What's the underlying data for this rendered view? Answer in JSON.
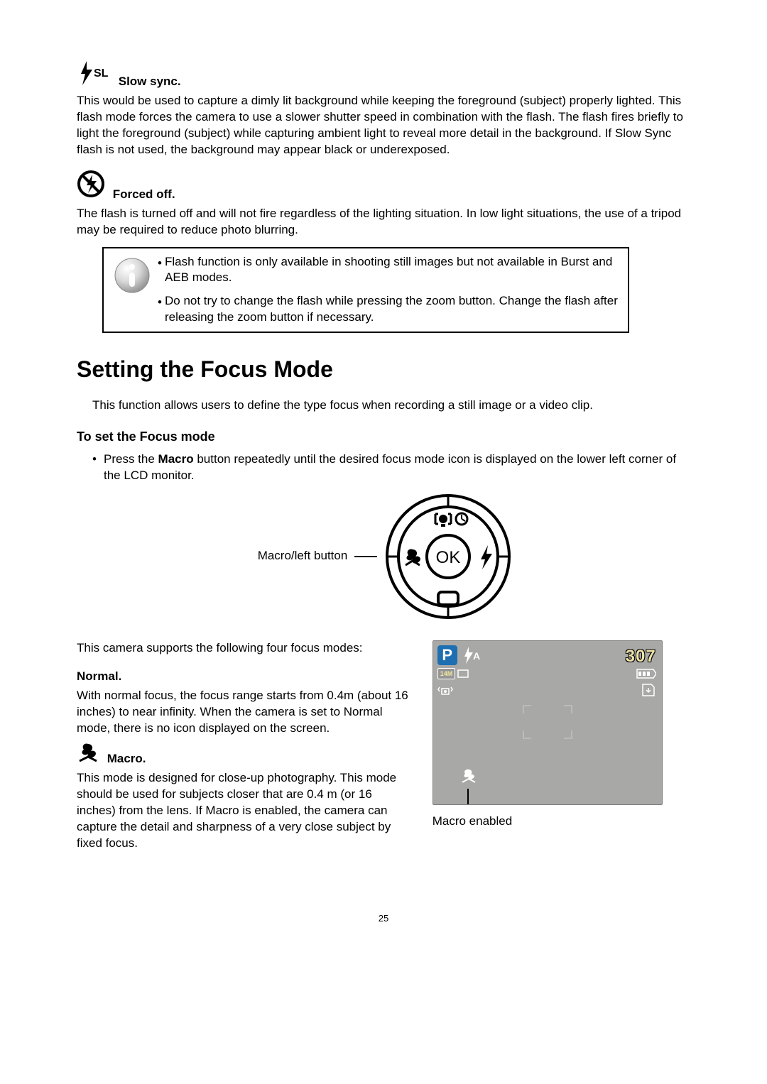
{
  "slow_sync": {
    "label_suffix": "SL",
    "title": "Slow sync.",
    "body": "This would be used to capture a dimly lit background while keeping the foreground (subject) properly lighted. This flash mode forces the camera to use a slower shutter speed in combination with the flash. The flash fires briefly to light the foreground (subject) while capturing ambient light to reveal more detail in the background. If Slow Sync flash is not used, the background may appear black or underexposed."
  },
  "forced_off": {
    "title": "Forced off.",
    "body": "The flash is turned off and will not fire regardless of the lighting situation. In low light situations, the use of a tripod may be required to reduce photo blurring."
  },
  "notice": {
    "item1": "Flash function is only available in shooting still images but not available in Burst and AEB modes.",
    "item2": "Do not try to change the flash while pressing the zoom button. Change the flash after releasing the zoom button if necessary."
  },
  "heading": "Setting the Focus Mode",
  "intro": "This function allows users to define the type focus when recording a still image or a video clip.",
  "subheading": "To set the Focus mode",
  "bullet_prefix": "Press the ",
  "bullet_bold": "Macro",
  "bullet_suffix": " button repeatedly until the desired focus mode icon is displayed on the lower left corner of the LCD monitor.",
  "diagram_label": "Macro/left button",
  "diagram_ok": "OK",
  "supported_intro": "This camera supports the following four focus modes:",
  "normal": {
    "title": "Normal.",
    "body": "With normal focus, the focus range starts from 0.4m (about 16 inches) to near infinity. When the camera is set to Normal mode, there is no icon displayed on the screen."
  },
  "macro": {
    "title": "Macro.",
    "body": "This mode is designed for close-up photography. This mode should be used for subjects closer that are 0.4 m (or 16 inches) from the lens. If Macro is enabled, the camera can capture the detail and sharpness of a very close subject by fixed focus."
  },
  "lcd": {
    "mode_letter": "P",
    "flash_label": "A",
    "shots": "307",
    "resolution": "14M",
    "caption": "Macro enabled"
  },
  "page_number": "25"
}
